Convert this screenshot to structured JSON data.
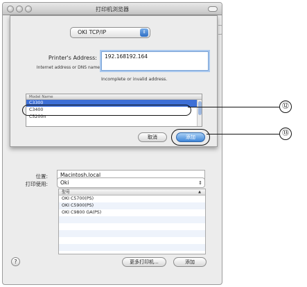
{
  "window": {
    "title": "打印机浏览器"
  },
  "background": {
    "location_label": "位置:",
    "location_value": "Macintosh.local",
    "print_using_label": "打印使用:",
    "print_using_value": "Oki",
    "model_header": "型号",
    "models": [
      "OKI C5700(PS)",
      "OKI C5900(PS)",
      "OKI C9800 GA(PS)",
      "",
      "",
      "",
      "",
      ""
    ],
    "more_printers_button": "更多打印机...",
    "add_button": "添加",
    "help_label": "?"
  },
  "sheet": {
    "protocol_value": "OKI TCP/IP",
    "address_label": "Printer's Address:",
    "address_sublabel": "Internet address or DNS name",
    "address_value": "192.168192.164",
    "address_message": "Incomplete or invalid address.",
    "list_header": "Model Name",
    "models": [
      "C3300",
      "C3400",
      "C5200n"
    ],
    "selected_index": 0,
    "cancel_button": "取消",
    "add_button": "添加"
  },
  "callouts": {
    "first": "⑫",
    "second": "⑬"
  },
  "colors": {
    "selection": "#3d6fd6",
    "default_button": "#3f86d8",
    "focus_ring": "#a9c8ee"
  }
}
